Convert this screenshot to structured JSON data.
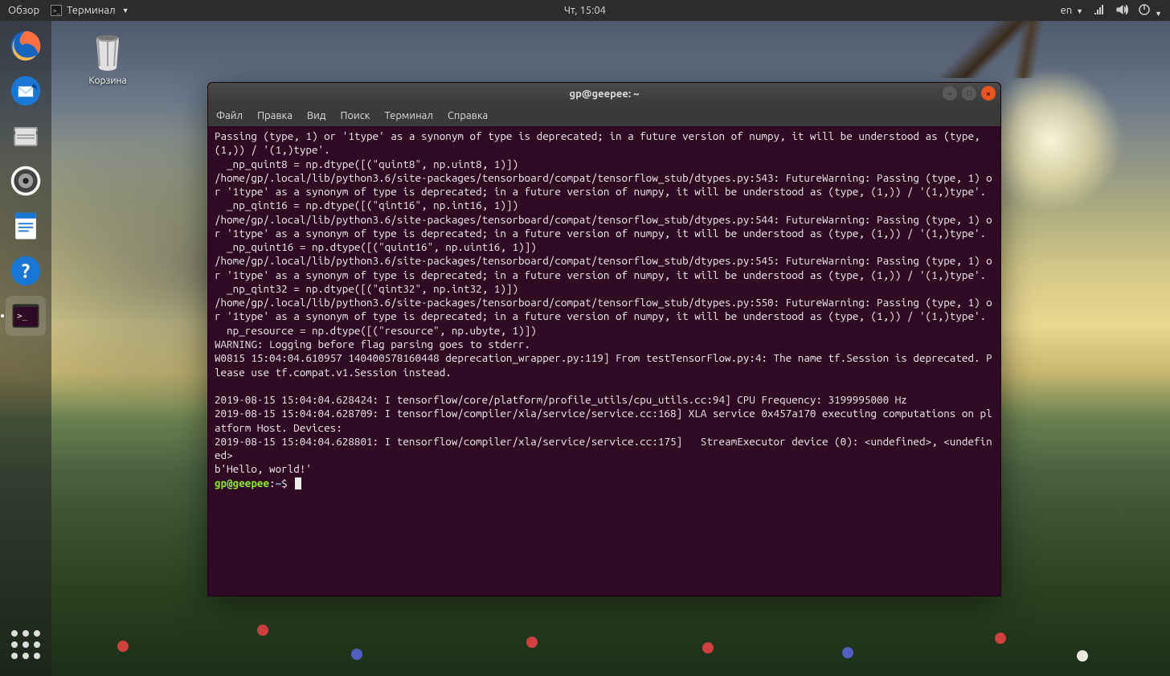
{
  "top_panel": {
    "overview": "Обзор",
    "terminal_app": "Терминал",
    "clock": "Чт, 15:04",
    "lang": "en"
  },
  "desktop": {
    "trash_label": "Корзина"
  },
  "dock_items": [
    {
      "name": "firefox"
    },
    {
      "name": "thunderbird"
    },
    {
      "name": "files"
    },
    {
      "name": "rhythmbox"
    },
    {
      "name": "writer"
    },
    {
      "name": "help"
    },
    {
      "name": "terminal",
      "active": true
    }
  ],
  "terminal": {
    "title": "gp@geepee: ~",
    "menu": [
      "Файл",
      "Правка",
      "Вид",
      "Поиск",
      "Терминал",
      "Справка"
    ],
    "lines": [
      "Passing (type, 1) or '1type' as a synonym of type is deprecated; in a future version of numpy, it will be understood as (type, (1,)) / '(1,)type'.",
      "  _np_quint8 = np.dtype([(\"quint8\", np.uint8, 1)])",
      "/home/gp/.local/lib/python3.6/site-packages/tensorboard/compat/tensorflow_stub/dtypes.py:543: FutureWarning: Passing (type, 1) or '1type' as a synonym of type is deprecated; in a future version of numpy, it will be understood as (type, (1,)) / '(1,)type'.",
      "  _np_qint16 = np.dtype([(\"qint16\", np.int16, 1)])",
      "/home/gp/.local/lib/python3.6/site-packages/tensorboard/compat/tensorflow_stub/dtypes.py:544: FutureWarning: Passing (type, 1) or '1type' as a synonym of type is deprecated; in a future version of numpy, it will be understood as (type, (1,)) / '(1,)type'.",
      "  _np_quint16 = np.dtype([(\"quint16\", np.uint16, 1)])",
      "/home/gp/.local/lib/python3.6/site-packages/tensorboard/compat/tensorflow_stub/dtypes.py:545: FutureWarning: Passing (type, 1) or '1type' as a synonym of type is deprecated; in a future version of numpy, it will be understood as (type, (1,)) / '(1,)type'.",
      "  _np_qint32 = np.dtype([(\"qint32\", np.int32, 1)])",
      "/home/gp/.local/lib/python3.6/site-packages/tensorboard/compat/tensorflow_stub/dtypes.py:550: FutureWarning: Passing (type, 1) or '1type' as a synonym of type is deprecated; in a future version of numpy, it will be understood as (type, (1,)) / '(1,)type'.",
      "  np_resource = np.dtype([(\"resource\", np.ubyte, 1)])",
      "WARNING: Logging before flag parsing goes to stderr.",
      "W0815 15:04:04.610957 140400578160448 deprecation_wrapper.py:119] From testTensorFlow.py:4: The name tf.Session is deprecated. Please use tf.compat.v1.Session instead.",
      "",
      "2019-08-15 15:04:04.628424: I tensorflow/core/platform/profile_utils/cpu_utils.cc:94] CPU Frequency: 3199995000 Hz",
      "2019-08-15 15:04:04.628709: I tensorflow/compiler/xla/service/service.cc:168] XLA service 0x457a170 executing computations on platform Host. Devices:",
      "2019-08-15 15:04:04.628801: I tensorflow/compiler/xla/service/service.cc:175]   StreamExecutor device (0): <undefined>, <undefined>",
      "b'Hello, world!'"
    ],
    "prompt": {
      "user": "gp@geepee",
      "path": "~",
      "symbol": "$"
    }
  }
}
